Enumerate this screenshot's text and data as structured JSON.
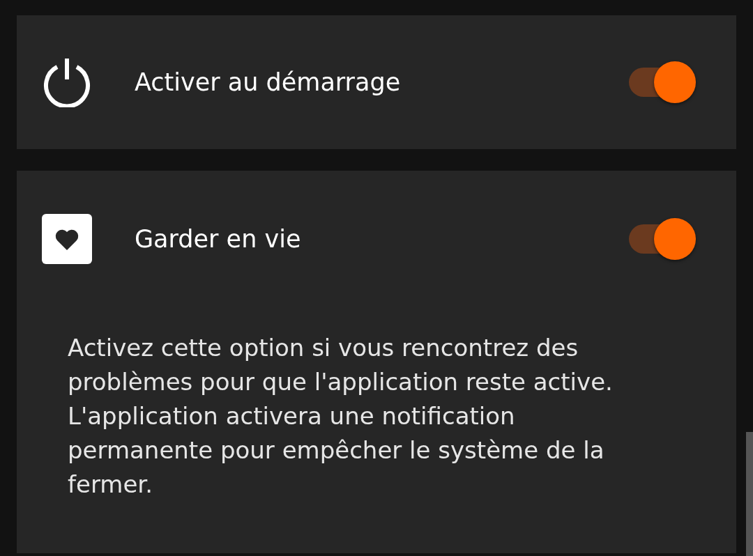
{
  "settings": [
    {
      "kind": "power",
      "label": "Activer au démarrage",
      "on": true
    },
    {
      "kind": "heart",
      "label": "Garder en vie",
      "on": true,
      "description": "Activez cette option si vous rencontrez des problèmes pour que l'application reste active. L'application activera une notification permanente pour empêcher le système de la fermer."
    }
  ]
}
